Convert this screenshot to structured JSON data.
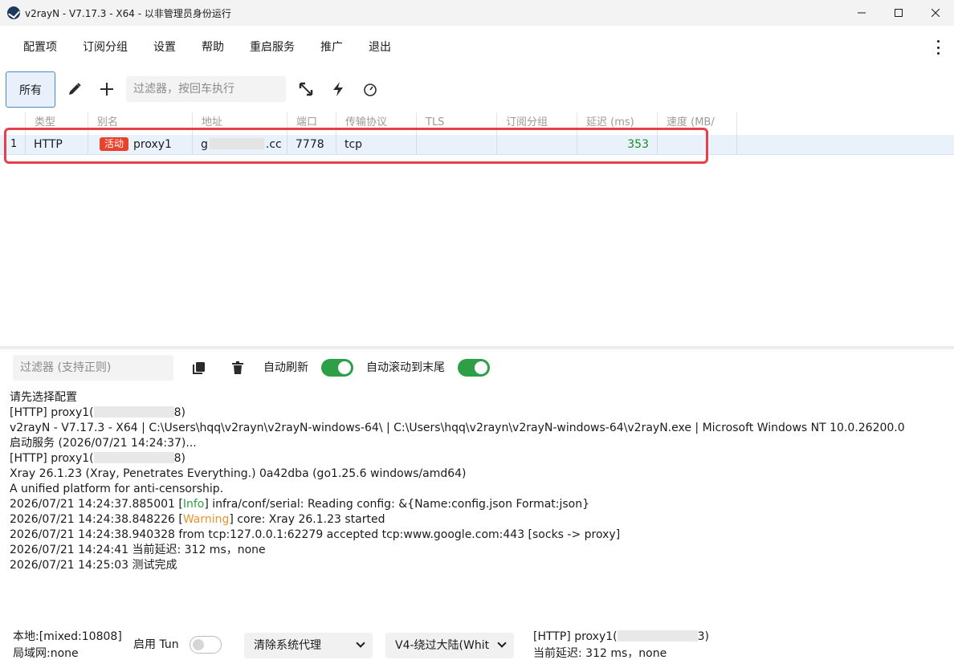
{
  "window": {
    "title": "v2rayN - V7.17.3 - X64 - 以非管理员身份运行",
    "controls": [
      "─",
      "☐",
      "✕"
    ]
  },
  "menu": {
    "items": [
      "配置项",
      "订阅分组",
      "设置",
      "帮助",
      "重启服务",
      "推广",
      "退出"
    ]
  },
  "toolbar": {
    "all_label": "所有",
    "filter_placeholder": "过滤器，按回车执行"
  },
  "grid": {
    "columns": [
      "类型",
      "别名",
      "地址",
      "端口",
      "传输协议",
      "TLS",
      "订阅分组",
      "延迟 (ms)",
      "速度 (MB/"
    ],
    "rows": [
      {
        "index": "1",
        "type": "HTTP",
        "badge": "活动",
        "alias": "proxy1",
        "address_start": "g",
        "address_end": ".cc",
        "port": "7778",
        "transport": "tcp",
        "tls": "",
        "group": "",
        "delay": "353",
        "speed": ""
      }
    ]
  },
  "log_toolbar": {
    "filter_placeholder": "过滤器 (支持正则)",
    "auto_refresh_label": "自动刷新",
    "auto_refresh": true,
    "auto_scroll_label": "自动滚动到末尾",
    "auto_scroll": true
  },
  "log": {
    "l1": "请先选择配置",
    "l2a": "[HTTP] proxy1(",
    "l2b": "8)",
    "l3": "v2rayN - V7.17.3 - X64 | C:\\Users\\hqq\\v2rayn\\v2rayN-windows-64\\ | C:\\Users\\hqq\\v2rayn\\v2rayN-windows-64\\v2rayN.exe | Microsoft Windows NT 10.0.26200.0",
    "l4": "启动服务 (2026/07/21 14:24:37)...",
    "l5a": "[HTTP] proxy1(",
    "l5b": "8)",
    "l6": "Xray 26.1.23 (Xray, Penetrates Everything.) 0a42dba (go1.25.6 windows/amd64)",
    "l7": "A unified platform for anti-censorship.",
    "l8a": "2026/07/21 14:24:37.885001 [",
    "l8b": "Info",
    "l8c": "] infra/conf/serial: Reading config: &{Name:config.json Format:json}",
    "l9a": "2026/07/21 14:24:38.848226 [",
    "l9b": "Warning",
    "l9c": "] core: Xray 26.1.23 started",
    "l10": "2026/07/21 14:24:38.940328 from tcp:127.0.0.1:62279 accepted tcp:www.google.com:443 [socks -> proxy]",
    "l11": "2026/07/21 14:24:41 当前延迟: 312 ms，none",
    "l12": "2026/07/21 14:25:03 测试完成"
  },
  "status": {
    "local": "本地:[mixed:10808]",
    "lan": "局域网:none",
    "tun_label": "启用 Tun",
    "tun_enabled": false,
    "proxy_mode": "清除系统代理",
    "routing": "V4-绕过大陆(Whit",
    "current_a": "[HTTP] proxy1(",
    "current_b": "3)",
    "current_delay": "当前延迟: 312 ms，none"
  },
  "colors": {
    "accent": "#4a8ac7",
    "active_badge": "#e8422c",
    "toggle_on": "#2e9e47",
    "highlight_box": "#e8404a",
    "delay_text": "#1a8a2a"
  }
}
